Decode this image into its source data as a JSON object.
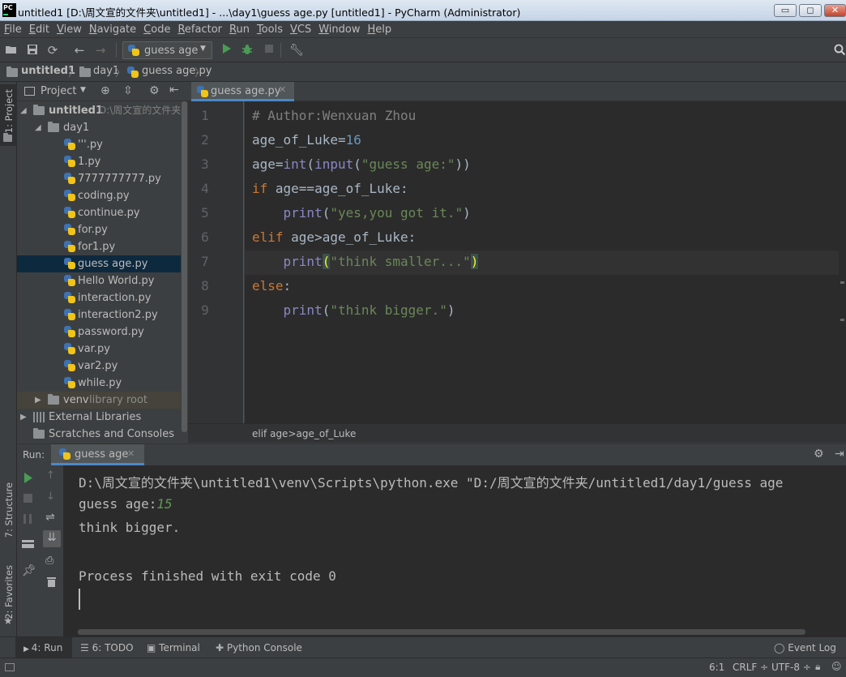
{
  "window": {
    "title": "untitled1 [D:\\周文宣的文件夹\\untitled1] - ...\\day1\\guess age.py [untitled1] - PyCharm (Administrator)",
    "logo_text": "PC",
    "minimize": "▭",
    "maximize": "◻",
    "close": "✕"
  },
  "menu": [
    "File",
    "Edit",
    "View",
    "Navigate",
    "Code",
    "Refactor",
    "Run",
    "Tools",
    "VCS",
    "Window",
    "Help"
  ],
  "toolbar": {
    "run_config": "guess age"
  },
  "breadcrumb": [
    "untitled1",
    "day1",
    "guess age.py"
  ],
  "left_stripe": {
    "project": "1: Project",
    "structure": "7: Structure",
    "favorites": "2: Favorites"
  },
  "project_panel": {
    "header": "Project",
    "root": {
      "name": "untitled1",
      "path": "D:\\周文宣的文件夹\\u"
    },
    "folder": "day1",
    "files": [
      "'''.py",
      "1.py",
      "7777777777.py",
      "coding.py",
      "continue.py",
      "for.py",
      "for1.py",
      "guess age.py",
      "Hello World.py",
      "interaction.py",
      "interaction2.py",
      "password.py",
      "var.py",
      "var2.py",
      "while.py"
    ],
    "selected_file": "guess age.py",
    "venv": "venv",
    "venv_note": "library root",
    "external": "External Libraries",
    "scratches": "Scratches and Consoles"
  },
  "editor": {
    "tab": "guess age.py",
    "line_numbers": [
      "1",
      "2",
      "3",
      "4",
      "5",
      "6",
      "7",
      "8",
      "9"
    ],
    "lines": {
      "l1": "# Author:Wenxuan Zhou",
      "l2a": "age_of_Luke=",
      "l2b": "16",
      "l3a": "age=",
      "l3b": "int",
      "l3c": "(",
      "l3d": "input",
      "l3e": "(",
      "l3f": "\"guess age:\"",
      "l3g": "))",
      "l4a": "if",
      "l4b": " age==age_of_Luke:",
      "l5a": "    ",
      "l5b": "print",
      "l5c": "(",
      "l5d": "\"yes,you got it.\"",
      "l5e": ")",
      "l6a": "elif",
      "l6b": " age>age_of_Luke:",
      "l7a": "    ",
      "l7b": "print",
      "l7c": "(",
      "l7d": "\"think smaller...\"",
      "l7e": ")",
      "l8a": "else",
      "l8b": ":",
      "l9a": "    ",
      "l9b": "print",
      "l9c": "(",
      "l9d": "\"think bigger.\"",
      "l9e": ")"
    },
    "breadcrumb": "elif age>age_of_Luke"
  },
  "run_panel": {
    "label": "Run:",
    "tab": "guess age",
    "output": {
      "cmd": "D:\\周文宣的文件夹\\untitled1\\venv\\Scripts\\python.exe \"D:/周文宣的文件夹/untitled1/day1/guess age",
      "prompt": "guess age:",
      "input": "15",
      "result": "think bigger.",
      "finished": "Process finished with exit code 0"
    }
  },
  "tool_windows": {
    "run": "4: Run",
    "todo": "6: TODO",
    "terminal": "Terminal",
    "python_console": "Python Console",
    "event_log": "Event Log"
  },
  "status": {
    "position": "6:1",
    "line_sep": "CRLF ÷",
    "encoding": "UTF-8 ÷"
  },
  "colors": {
    "keyword": "#cc7832",
    "string": "#6a8759",
    "number": "#6897bb",
    "builtin": "#8888c6",
    "comment": "#808080",
    "selection": "#0d293e"
  }
}
